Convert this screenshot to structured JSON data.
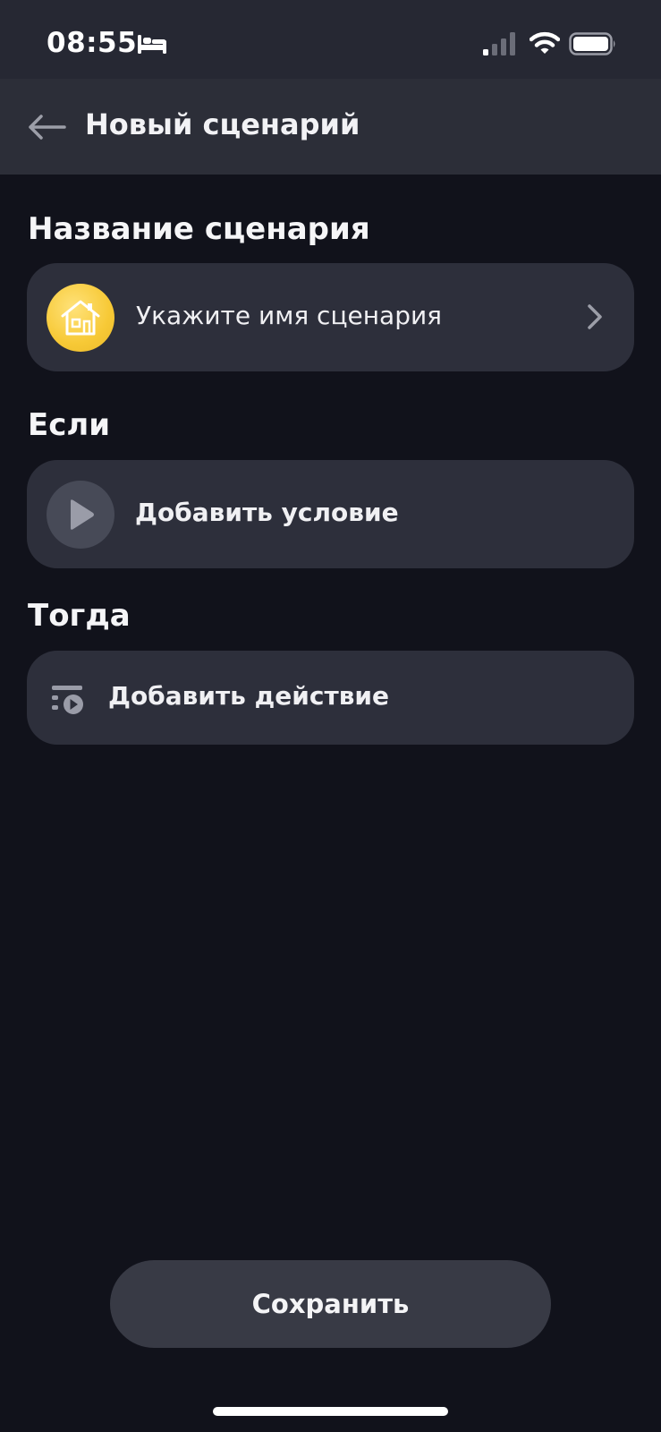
{
  "status_bar": {
    "time": "08:55",
    "icons": [
      "bed-icon",
      "signal-icon",
      "wifi-icon",
      "battery-icon"
    ]
  },
  "header": {
    "back_icon": "arrow-left-icon",
    "title": "Новый сценарий"
  },
  "sections": {
    "name": {
      "label": "Название сценария",
      "placeholder": "Укажите имя сценария",
      "icon": "home-icon",
      "icon_color": "#f7c936"
    },
    "if": {
      "label": "Если",
      "button_label": "Добавить условие",
      "icon": "play-icon"
    },
    "then": {
      "label": "Тогда",
      "button_label": "Добавить действие",
      "icon": "action-list-icon"
    }
  },
  "footer": {
    "save_label": "Сохранить"
  },
  "colors": {
    "background": "#11121b",
    "card": "#2d2f3b",
    "header": "#2c2e38",
    "accent_yellow": "#f7c936"
  }
}
